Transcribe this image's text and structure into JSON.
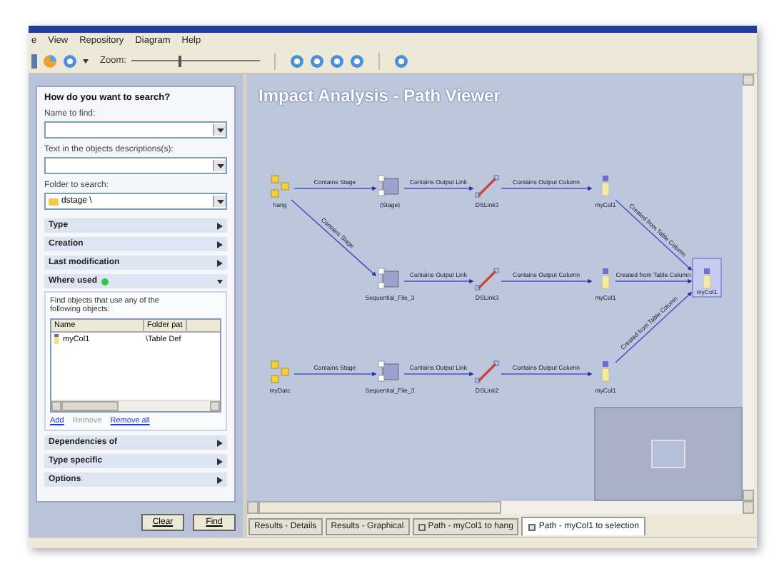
{
  "menu": [
    "e",
    "View",
    "Repository",
    "Diagram",
    "Help"
  ],
  "toolbar": {
    "zoom_label": "Zoom:",
    "zoom": {
      "level": 0.36
    }
  },
  "search": {
    "heading": "How do you want to search?",
    "fields": [
      {
        "label": "Name to find:",
        "kind": "text"
      },
      {
        "label": "Text in the objects descriptions(s):",
        "kind": "text"
      },
      {
        "label": "Folder to search:",
        "kind": "folder",
        "value": "dstage \\"
      }
    ],
    "sections": [
      {
        "label": "Type",
        "expanded": false,
        "has_criteria": false
      },
      {
        "label": "Creation",
        "expanded": false,
        "has_criteria": false
      },
      {
        "label": "Last modification",
        "expanded": false,
        "has_criteria": false
      },
      {
        "label": "Where used",
        "expanded": true,
        "has_criteria": true,
        "description": "Find objects that use any of the following objects:",
        "columns": [
          "Name",
          "Folder pat"
        ],
        "rows": [
          [
            "myCol1",
            "\\Table Def"
          ]
        ],
        "links": [
          {
            "label": "Add",
            "disabled": false
          },
          {
            "label": "Remove",
            "disabled": true
          },
          {
            "label": "Remove all",
            "disabled": false
          }
        ]
      },
      {
        "label": "Dependencies of",
        "expanded": false,
        "has_criteria": false
      },
      {
        "label": "Type specific",
        "expanded": false,
        "has_criteria": false
      },
      {
        "label": "Options",
        "expanded": false,
        "has_criteria": false
      }
    ],
    "buttons": [
      "Clear",
      "Find"
    ]
  },
  "diagram": {
    "title": "Impact Analysis - Path Viewer",
    "rows": [
      {
        "items": [
          {
            "kind": "source",
            "label": "hang"
          },
          {
            "kind": "stage",
            "label": "(Stage)"
          },
          {
            "kind": "link",
            "label": "DSLink3"
          },
          {
            "kind": "column",
            "label": "myCol1"
          }
        ],
        "links": [
          "Contains Stage",
          "Contains Output Link",
          "Contains Output Column"
        ],
        "to_target": "Created from Table Column"
      },
      {
        "incoming": "Contains Stage",
        "items": [
          {
            "kind": "stage",
            "label": "Sequential_File_3"
          },
          {
            "kind": "link",
            "label": "DSLink3"
          },
          {
            "kind": "column",
            "label": "myCol1"
          }
        ],
        "links": [
          "Contains Output Link",
          "Contains Output Column"
        ],
        "to_target": "Created from Table Column"
      },
      {
        "items": [
          {
            "kind": "source",
            "label": "myDatc"
          },
          {
            "kind": "stage",
            "label": "Sequential_File_3"
          },
          {
            "kind": "link",
            "label": "DSLink2"
          },
          {
            "kind": "column",
            "label": "myCol1"
          }
        ],
        "links": [
          "Contains Stage",
          "Contains Output Link",
          "Contains Output Column"
        ],
        "to_target": "Created from Table Column"
      }
    ],
    "target": {
      "kind": "column",
      "label": "myCol1",
      "selected": true
    }
  },
  "tabs": [
    {
      "label": "Results - Details",
      "selected": false,
      "closable": false
    },
    {
      "label": "Results - Graphical",
      "selected": false,
      "closable": false
    },
    {
      "label": "Path - myCol1 to hang",
      "selected": false,
      "closable": true
    },
    {
      "label": "Path - myCol1 to selection",
      "selected": true,
      "closable": true
    }
  ]
}
